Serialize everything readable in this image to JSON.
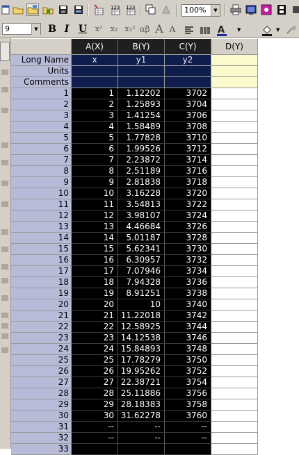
{
  "toolbar": {
    "zoom_value": "100%",
    "font_size": "9",
    "format_buttons": [
      "B",
      "I",
      "U",
      "x²",
      "x₂",
      "x₁²",
      "αβ",
      "A",
      "A"
    ]
  },
  "sheet": {
    "columns": [
      "A(X)",
      "B(Y)",
      "C(Y)",
      "D(Y)"
    ],
    "label_rows": [
      {
        "name": "Long Name",
        "values": [
          "x",
          "y1",
          "y2",
          ""
        ]
      },
      {
        "name": "Units",
        "values": [
          "",
          "",
          "",
          ""
        ]
      },
      {
        "name": "Comments",
        "values": [
          "",
          "",
          "",
          ""
        ]
      }
    ],
    "rows": [
      [
        "1",
        "1",
        "1.12202",
        "3702"
      ],
      [
        "2",
        "2",
        "1.25893",
        "3704"
      ],
      [
        "3",
        "3",
        "1.41254",
        "3706"
      ],
      [
        "4",
        "4",
        "1.58489",
        "3708"
      ],
      [
        "5",
        "5",
        "1.77828",
        "3710"
      ],
      [
        "6",
        "6",
        "1.99526",
        "3712"
      ],
      [
        "7",
        "7",
        "2.23872",
        "3714"
      ],
      [
        "8",
        "8",
        "2.51189",
        "3716"
      ],
      [
        "9",
        "9",
        "2.81838",
        "3718"
      ],
      [
        "10",
        "10",
        "3.16228",
        "3720"
      ],
      [
        "11",
        "11",
        "3.54813",
        "3722"
      ],
      [
        "12",
        "12",
        "3.98107",
        "3724"
      ],
      [
        "13",
        "13",
        "4.46684",
        "3726"
      ],
      [
        "14",
        "14",
        "5.01187",
        "3728"
      ],
      [
        "15",
        "15",
        "5.62341",
        "3730"
      ],
      [
        "16",
        "16",
        "6.30957",
        "3732"
      ],
      [
        "17",
        "17",
        "7.07946",
        "3734"
      ],
      [
        "18",
        "18",
        "7.94328",
        "3736"
      ],
      [
        "19",
        "19",
        "8.91251",
        "3738"
      ],
      [
        "20",
        "20",
        "10",
        "3740"
      ],
      [
        "21",
        "21",
        "11.22018",
        "3742"
      ],
      [
        "22",
        "22",
        "12.58925",
        "3744"
      ],
      [
        "23",
        "23",
        "14.12538",
        "3746"
      ],
      [
        "24",
        "24",
        "15.84893",
        "3748"
      ],
      [
        "25",
        "25",
        "17.78279",
        "3750"
      ],
      [
        "26",
        "26",
        "19.95262",
        "3752"
      ],
      [
        "27",
        "27",
        "22.38721",
        "3754"
      ],
      [
        "28",
        "28",
        "25.11886",
        "3756"
      ],
      [
        "29",
        "29",
        "28.18383",
        "3758"
      ],
      [
        "30",
        "30",
        "31.62278",
        "3760"
      ],
      [
        "31",
        "--",
        "--",
        "--"
      ],
      [
        "32",
        "--",
        "--",
        "--"
      ],
      [
        "33",
        "",
        "",
        ""
      ]
    ]
  }
}
